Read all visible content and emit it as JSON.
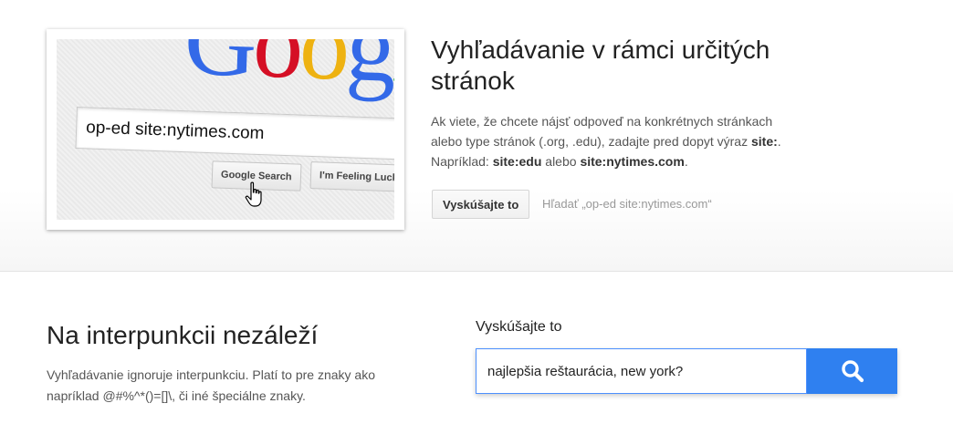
{
  "site_search": {
    "title": "Vyhľadávanie v rámci určitých stránok",
    "desc_intro": "Ak viete, že chcete nájsť odpoveď na konkrétnych stránkach alebo type stránok (.org, .edu), zadajte pred dopyt výraz ",
    "desc_operator": "site:",
    "desc_example_prefix": ". Napríklad: ",
    "desc_example_1": "site:edu",
    "desc_example_or": " alebo ",
    "desc_example_2": "site:nytimes.com",
    "desc_end": ".",
    "try_button": "Vyskúšajte to",
    "try_hint": "Hľadať „op-ed site:nytimes.com“",
    "illustration": {
      "query": "op-ed site:nytimes.com",
      "search_button": "Google Search",
      "lucky_button": "I'm Feeling Lucky"
    }
  },
  "punctuation": {
    "title": "Na interpunkcii nezáleží",
    "desc": "Vyhľadávanie ignoruje interpunkciu. Platí to pre znaky ako napríklad @#%^*()=[]\\, či iné špeciálne znaky.",
    "try_label": "Vyskúšajte to",
    "input_value": "najlepšia reštaurácia, new york?",
    "search_icon": "search-icon"
  },
  "colors": {
    "accent_blue": "#2f80f0",
    "input_border": "#4d90fe",
    "google_blue": "#3369e8",
    "google_red": "#d50f25",
    "google_yellow": "#eeb211",
    "google_green": "#009925"
  }
}
